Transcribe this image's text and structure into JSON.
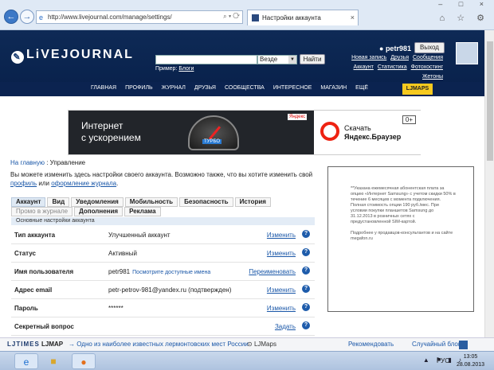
{
  "browser": {
    "url": "http://www.livejournal.com/manage/settings/",
    "tab_title": "Настройки аккаунта",
    "back_icon": "←",
    "fwd_icon": "→",
    "close_glyph": "×",
    "window_controls": "– □ ×",
    "toolbar_icons": "⌂ ☆ ⚙"
  },
  "header": {
    "logo": "LiVEJOURNAL",
    "search_scope": "Везде",
    "search_button": "Найти",
    "example_label": "Пример:",
    "example_link": "Блоги",
    "username": "petr981",
    "exit": "Выход",
    "links_row1": [
      "Новая запись",
      "Друзья",
      "Сообщения"
    ],
    "links_row2": [
      "Аккаунт",
      "Статистика",
      "Фотохостинг"
    ],
    "links_row3": [
      "Жетоны"
    ],
    "menu": [
      "ГЛАВНАЯ",
      "ПРОФИЛЬ",
      "ЖУРНАЛ",
      "ДРУЗЬЯ",
      "СООБЩЕСТВА",
      "ИНТЕРЕСНОЕ",
      "МАГАЗИН",
      "ЕЩЁ"
    ],
    "ljmaps": "LJMAPS"
  },
  "banner": {
    "left_text_1": "Интернет",
    "left_text_2": "с ускорением",
    "turbo": "ТУРБО",
    "yandex_small": "Яндекс",
    "right_text_1": "Скачать",
    "right_text_2": "Яндекс.Браузер",
    "age": "0+"
  },
  "page": {
    "crumb_link": "На главную",
    "crumb_sep": " : ",
    "crumb_current": "Управление",
    "intro_1": "Вы можете изменить здесь настройки своего аккаунта. Возможно также, что вы хотите изменить свой ",
    "intro_link1": "профиль",
    "intro_mid": " или ",
    "intro_link2": "оформление журнала",
    "intro_end": "."
  },
  "tabs_row1": [
    "Аккаунт",
    "Вид",
    "Уведомления",
    "Мобильность",
    "Безопасность",
    "История"
  ],
  "tabs_row2": [
    "Промо в журнале",
    "Дополнения",
    "Реклама"
  ],
  "subhead": "Основные настройки аккаунта",
  "settings": [
    {
      "label": "Тип аккаунта",
      "value": "Улучшенный аккаунт",
      "hint": "",
      "action": "Изменить"
    },
    {
      "label": "Статус",
      "value": "Активный",
      "hint": "",
      "action": "Изменить"
    },
    {
      "label": "Имя пользователя",
      "value": "petr981",
      "hint": "Посмотрите доступные имена",
      "action": "Переименовать"
    },
    {
      "label": "Адрес email",
      "value": "petr-petrov-981@yandex.ru (подтвержден)",
      "hint": "",
      "action": "Изменить"
    },
    {
      "label": "Пароль",
      "value": "******",
      "hint": "",
      "action": "Изменить"
    },
    {
      "label": "Секретный вопрос",
      "value": "",
      "hint": "",
      "action": "Задать"
    }
  ],
  "help_glyph": "?",
  "ad": {
    "text_1": "**Указана ежемесячная абонентская плата за опцию «Интернет Samsung» с учетом скидки 50% в течение 6 месяцев с момента подключения. Полная стоимость опции 190 руб./мес. При условии покупки планшетов Samsung до 31.12.2013 в розничных сетях с предустановленной SIM-картой.",
    "text_2": "Подробнее у продавцов-консультантов и на сайте megafon.ru"
  },
  "mapbar": {
    "brand": "LJTIMES",
    "ljmap": "LJMAP",
    "news": "→ Одно из наиболее известных лермонтовских мест России",
    "ljmaps": "LJMaps",
    "recommend": "Рекомендовать",
    "random": "Случайный блог"
  },
  "taskbar": {
    "ie_icon": "e",
    "folder_icon": "■",
    "firefox_icon": "●",
    "tray": "▲ ⚑ ▮ ♪",
    "lang": "РУС",
    "time": "13:05",
    "date": "28.08.2013"
  }
}
